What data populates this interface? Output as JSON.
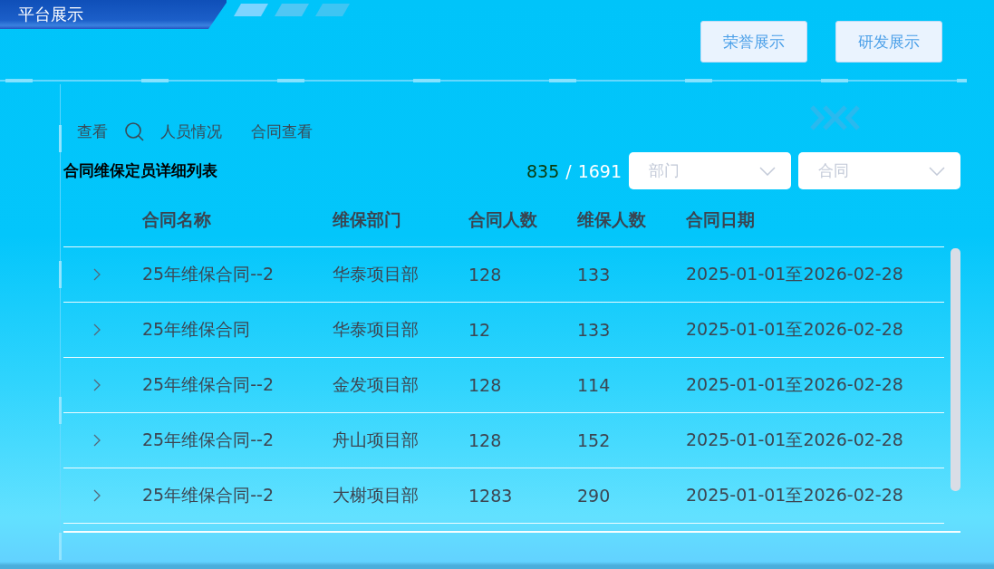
{
  "header": {
    "title": "平台展示",
    "buttons": [
      {
        "label": "荣誉展示"
      },
      {
        "label": "研发展示"
      }
    ]
  },
  "toolbar": [
    {
      "kind": "link",
      "label": "查看"
    },
    {
      "kind": "search"
    },
    {
      "kind": "link",
      "label": "人员情况"
    },
    {
      "kind": "link",
      "label": "合同查看"
    }
  ],
  "list_title": "合同维保定员详细列表",
  "counter": {
    "shown": "835",
    "separator": "/",
    "total": "1691"
  },
  "filters": [
    {
      "placeholder": "部门"
    },
    {
      "placeholder": "合同"
    }
  ],
  "table": {
    "columns": [
      "合同名称",
      "维保部门",
      "合同人数",
      "维保人数",
      "合同日期"
    ],
    "rows": [
      {
        "expanded": false,
        "cells": [
          "25年维保合同--2",
          "华泰项目部",
          "128",
          "133",
          "2025-01-01至2026-02-28"
        ]
      },
      {
        "expanded": false,
        "cells": [
          "25年维保合同",
          "华泰项目部",
          "12",
          "133",
          "2025-01-01至2026-02-28"
        ]
      },
      {
        "expanded": false,
        "cells": [
          "25年维保合同--2",
          "金发项目部",
          "128",
          "114",
          "2025-01-01至2026-02-28"
        ]
      },
      {
        "expanded": false,
        "cells": [
          "25年维保合同--2",
          "舟山项目部",
          "128",
          "152",
          "2025-01-01至2026-02-28"
        ]
      },
      {
        "expanded": false,
        "cells": [
          "25年维保合同--2",
          "大榭项目部",
          "1283",
          "290",
          "2025-01-01至2026-02-28"
        ]
      }
    ]
  }
}
